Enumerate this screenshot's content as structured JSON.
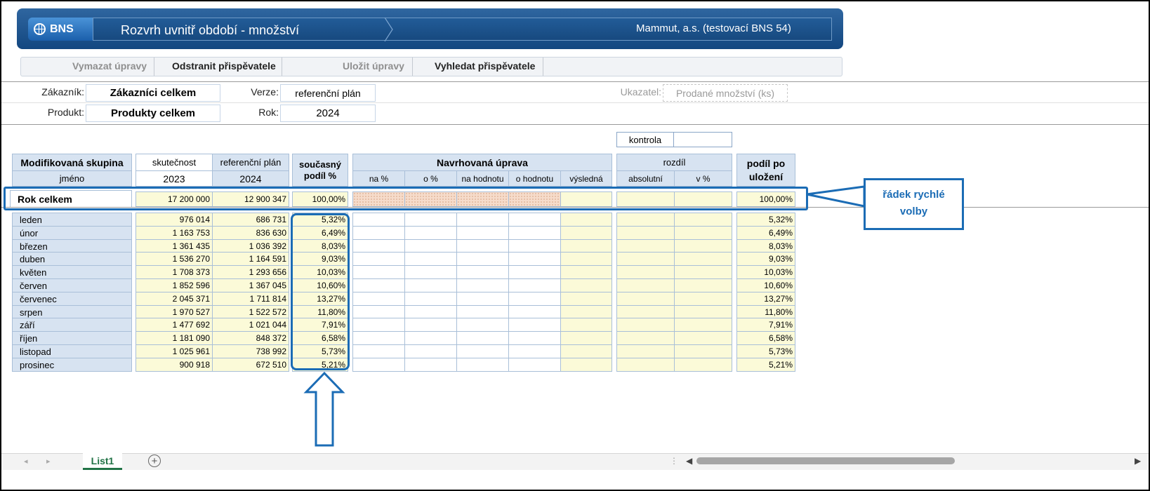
{
  "app": {
    "logo": "BNS",
    "title": "Rozvrh uvnitř období - množství",
    "company": "Mammut, a.s. (testovací BNS 54)"
  },
  "toolbar": [
    {
      "label": "Vymazat úpravy",
      "enabled": false
    },
    {
      "label": "Odstranit přispěvatele",
      "enabled": true
    },
    {
      "label": "Uložit úpravy",
      "enabled": false
    },
    {
      "label": "Vyhledat přispěvatele",
      "enabled": true
    }
  ],
  "params": {
    "customer_label": "Zákazník:",
    "customer_value": "Zákazníci celkem",
    "product_label": "Produkt:",
    "product_value": "Produkty celkem",
    "version_label": "Verze:",
    "version_value": "referenční plán",
    "year_label": "Rok:",
    "year_value": "2024",
    "indicator_label": "Ukazatel:",
    "indicator_value": "Prodané množství (ks)"
  },
  "kontrola": {
    "label": "kontrola",
    "value": ""
  },
  "table": {
    "headers": {
      "group": "Modifikovaná skupina",
      "name": "jméno",
      "actual": "skutečnost",
      "actual_year": "2023",
      "ref_plan": "referenční plán",
      "ref_year": "2024",
      "share": "současný podíl %",
      "proposed": "Navrhovaná úprava",
      "proposed_cols": [
        "na %",
        "o %",
        "na hodnotu",
        "o hodnotu",
        "výsledná"
      ],
      "diff": "rozdíl",
      "diff_cols": [
        "absolutní",
        "v %"
      ],
      "after": "podíl po uložení"
    },
    "total": {
      "label": "Rok celkem",
      "actual": "17 200 000",
      "ref": "12 900 347",
      "share": "100,00%",
      "after": "100,00%"
    },
    "rows": [
      {
        "month": "leden",
        "actual": "976 014",
        "ref": "686 731",
        "share": "5,32%",
        "after": "5,32%"
      },
      {
        "month": "únor",
        "actual": "1 163 753",
        "ref": "836 630",
        "share": "6,49%",
        "after": "6,49%"
      },
      {
        "month": "březen",
        "actual": "1 361 435",
        "ref": "1 036 392",
        "share": "8,03%",
        "after": "8,03%"
      },
      {
        "month": "duben",
        "actual": "1 536 270",
        "ref": "1 164 591",
        "share": "9,03%",
        "after": "9,03%"
      },
      {
        "month": "květen",
        "actual": "1 708 373",
        "ref": "1 293 656",
        "share": "10,03%",
        "after": "10,03%"
      },
      {
        "month": "červen",
        "actual": "1 852 596",
        "ref": "1 367 045",
        "share": "10,60%",
        "after": "10,60%"
      },
      {
        "month": "červenec",
        "actual": "2 045 371",
        "ref": "1 711 814",
        "share": "13,27%",
        "after": "13,27%"
      },
      {
        "month": "srpen",
        "actual": "1 970 527",
        "ref": "1 522 572",
        "share": "11,80%",
        "after": "11,80%"
      },
      {
        "month": "září",
        "actual": "1 477 692",
        "ref": "1 021 044",
        "share": "7,91%",
        "after": "7,91%"
      },
      {
        "month": "říjen",
        "actual": "1 181 090",
        "ref": "848 372",
        "share": "6,58%",
        "after": "6,58%"
      },
      {
        "month": "listopad",
        "actual": "1 025 961",
        "ref": "738 992",
        "share": "5,73%",
        "after": "5,73%"
      },
      {
        "month": "prosinec",
        "actual": "900 918",
        "ref": "672 510",
        "share": "5,21%",
        "after": "5,21%"
      }
    ]
  },
  "annotation": {
    "line1": "řádek rychlé",
    "line2": "volby",
    "color": "#1b6cb5"
  },
  "sheet_tab": "List1",
  "icons": {
    "logo": "globe-icon",
    "add_sheet": "plus-icon"
  }
}
